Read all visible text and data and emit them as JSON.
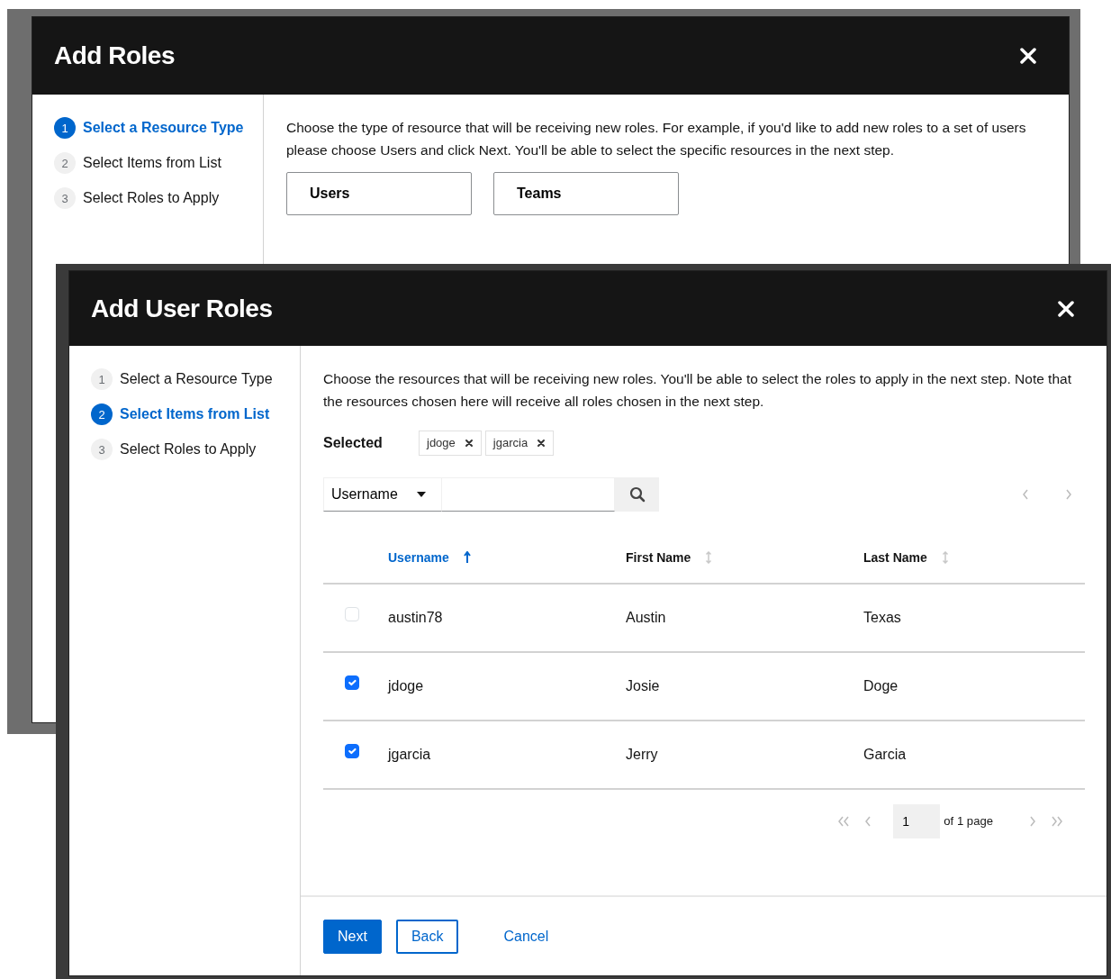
{
  "dialogs": [
    {
      "title": "Add Roles",
      "steps": [
        {
          "number": "1",
          "label": "Select a Resource Type",
          "selected": true
        },
        {
          "number": "2",
          "label": "Select Items from List",
          "selected": false
        },
        {
          "number": "3",
          "label": "Select Roles to Apply",
          "selected": false
        }
      ],
      "description": "Choose the type of resource that will be receiving new roles. For example, if you'd like to add new roles to a set of users please choose Users and click Next. You'll be able to select the specific resources in the next step.",
      "resource_types": [
        {
          "label": "Users"
        },
        {
          "label": "Teams"
        }
      ]
    },
    {
      "title": "Add User Roles",
      "steps": [
        {
          "number": "1",
          "label": "Select a Resource Type",
          "selected": false
        },
        {
          "number": "2",
          "label": "Select Items from List",
          "selected": true
        },
        {
          "number": "3",
          "label": "Select Roles to Apply",
          "selected": false
        }
      ],
      "description": "Choose the resources that will be receiving new roles. You'll be able to select the roles to apply in the next step. Note that the resources chosen here will receive all roles chosen in the next step.",
      "selected_label": "Selected",
      "chips": [
        {
          "label": "jdoge"
        },
        {
          "label": "jgarcia"
        }
      ],
      "search": {
        "filter": "Username"
      },
      "columns": [
        {
          "label": "Username",
          "sorted": true
        },
        {
          "label": "First Name",
          "sorted": false
        },
        {
          "label": "Last Name",
          "sorted": false
        }
      ],
      "rows": [
        {
          "checked": false,
          "cells": [
            "austin78",
            "Austin",
            "Texas"
          ]
        },
        {
          "checked": true,
          "cells": [
            "jdoge",
            "Josie",
            "Doge"
          ]
        },
        {
          "checked": true,
          "cells": [
            "jgarcia",
            "Jerry",
            "Garcia"
          ]
        }
      ],
      "pagination": {
        "page": "1",
        "total": "of 1 page"
      },
      "buttons": [
        {
          "label": "Next",
          "kind": "primary"
        },
        {
          "label": "Back",
          "kind": "secondary"
        },
        {
          "label": "Cancel",
          "kind": "link"
        }
      ]
    }
  ]
}
